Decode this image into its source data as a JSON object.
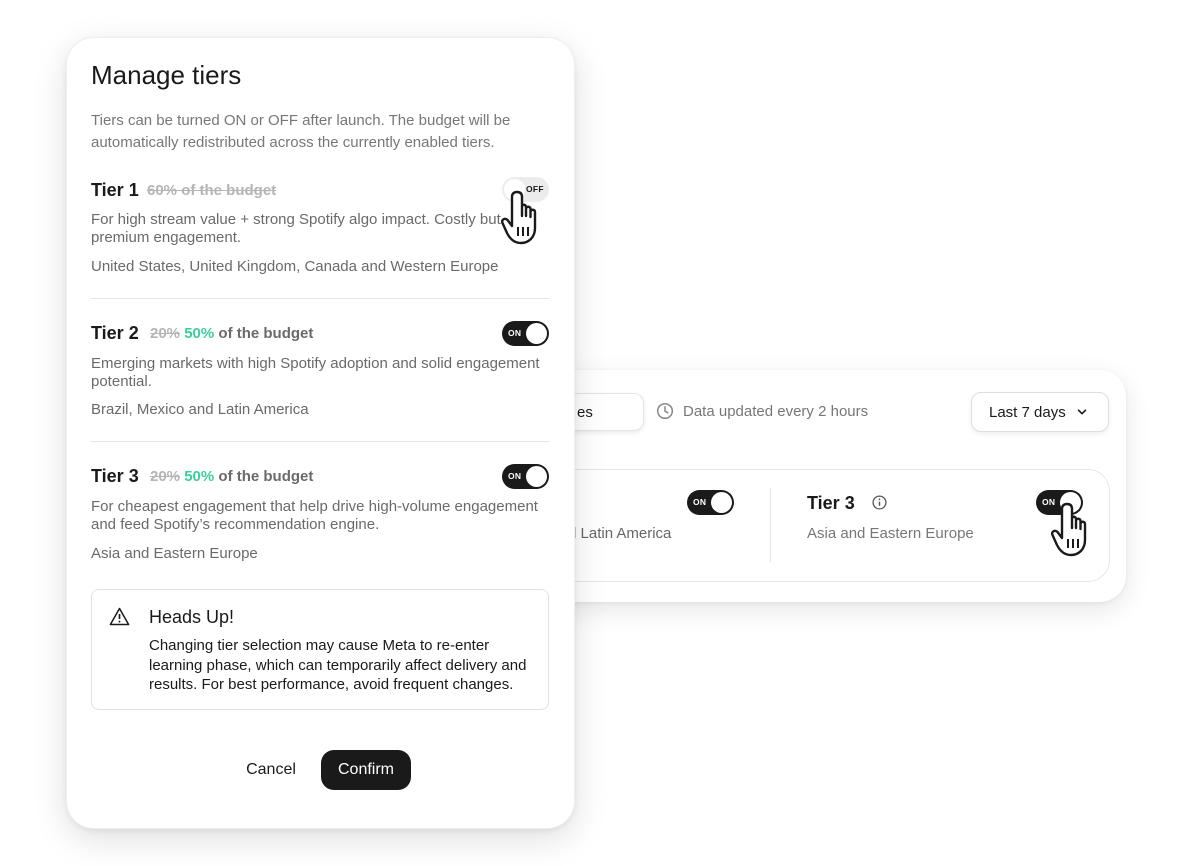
{
  "dashboard": {
    "partial_chip_label": "es",
    "data_updated": "Data updated every 2 hours",
    "date_range": "Last 7 days",
    "region_left_partial": "d Latin America",
    "tier3": {
      "title": "Tier 3",
      "regions": "Asia and Eastern Europe",
      "toggle": "ON"
    },
    "tier2_toggle": "ON"
  },
  "modal": {
    "title": "Manage tiers",
    "description": "Tiers can be turned ON or OFF after launch. The budget will be automatically redistributed across the currently enabled tiers.",
    "tiers": [
      {
        "name": "Tier 1",
        "budget_old": "60% of the budget",
        "toggle": "OFF",
        "enabled": false,
        "description": "For high stream value + strong Spotify algo impact. Costly but premium engagement.",
        "regions": "United States, United Kingdom, Canada and Western Europe"
      },
      {
        "name": "Tier 2",
        "budget_old": "20%",
        "budget_new": "50%",
        "budget_suffix": "of the budget",
        "toggle": "ON",
        "enabled": true,
        "description": "Emerging markets with high Spotify adoption and solid engagement potential.",
        "regions": "Brazil, Mexico and Latin America"
      },
      {
        "name": "Tier 3",
        "budget_old": "20%",
        "budget_new": "50%",
        "budget_suffix": "of the budget",
        "toggle": "ON",
        "enabled": true,
        "description": "For cheapest engagement that help drive high-volume engagement and feed Spotify’s recommendation engine.",
        "regions": "Asia and Eastern Europe"
      }
    ],
    "alert": {
      "title": "Heads Up!",
      "body": "Changing tier selection may cause Meta to re-enter learning phase, which can temporarily affect delivery and results. For best performance, avoid frequent changes."
    },
    "cancel_label": "Cancel",
    "confirm_label": "Confirm"
  },
  "colors": {
    "accent_green": "#3bcf9c",
    "toggle_on": "#1a1a1a",
    "toggle_off": "#ececec",
    "primary_button": "#1a1a1a"
  },
  "icons": [
    "clock-icon",
    "chevron-down-icon",
    "info-icon",
    "warning-icon",
    "hand-pointer-icon"
  ]
}
